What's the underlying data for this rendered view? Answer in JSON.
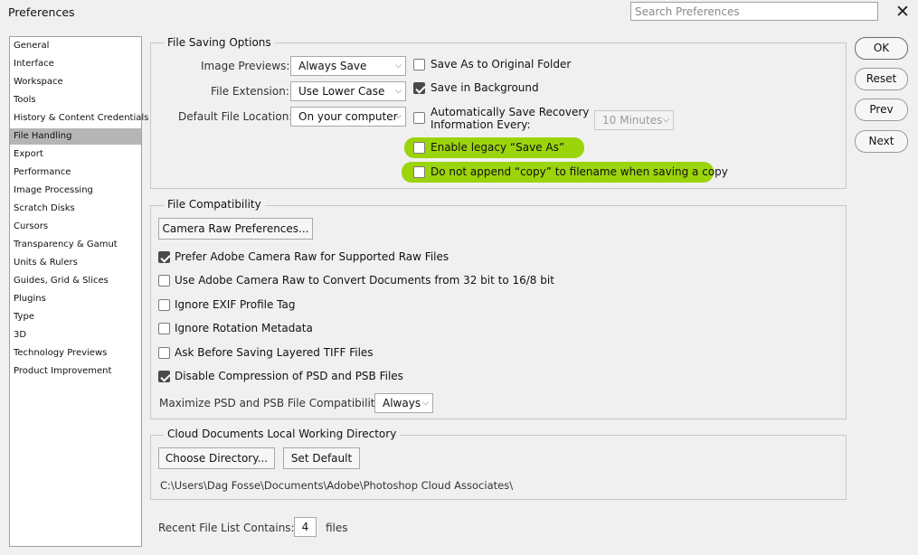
{
  "window": {
    "title": "Preferences",
    "search_placeholder": "Search Preferences"
  },
  "sidebar": {
    "items": [
      {
        "label": "General"
      },
      {
        "label": "Interface"
      },
      {
        "label": "Workspace"
      },
      {
        "label": "Tools"
      },
      {
        "label": "History & Content Credentials"
      },
      {
        "label": "File Handling",
        "selected": true
      },
      {
        "label": "Export"
      },
      {
        "label": "Performance"
      },
      {
        "label": "Image Processing"
      },
      {
        "label": "Scratch Disks"
      },
      {
        "label": "Cursors"
      },
      {
        "label": "Transparency & Gamut"
      },
      {
        "label": "Units & Rulers"
      },
      {
        "label": "Guides, Grid & Slices"
      },
      {
        "label": "Plugins"
      },
      {
        "label": "Type"
      },
      {
        "label": "3D"
      },
      {
        "label": "Technology Previews"
      },
      {
        "label": "Product Improvement"
      }
    ]
  },
  "file_saving": {
    "legend": "File Saving Options",
    "image_previews": {
      "label": "Image Previews:",
      "value": "Always Save"
    },
    "file_extension": {
      "label": "File Extension:",
      "value": "Use Lower Case"
    },
    "default_location": {
      "label": "Default File Location:",
      "value": "On your computer"
    },
    "save_as_original": {
      "label": "Save As to Original Folder",
      "checked": false
    },
    "save_background": {
      "label": "Save in Background",
      "checked": true
    },
    "auto_recovery": {
      "label_line1": "Automatically Save Recovery",
      "label_line2": "Information Every:",
      "checked": false
    },
    "recovery_interval": {
      "value": "10 Minutes"
    },
    "legacy_save_as": {
      "label": "Enable legacy “Save As”",
      "checked": false
    },
    "no_copy_append": {
      "label": "Do not append “copy” to filename when saving a copy",
      "checked": false
    }
  },
  "file_compat": {
    "legend": "File Compatibility",
    "camera_raw_button": "Camera Raw Preferences...",
    "options": [
      {
        "label": "Prefer Adobe Camera Raw for Supported Raw Files",
        "checked": true
      },
      {
        "label": "Use Adobe Camera Raw to Convert Documents from 32 bit to 16/8 bit",
        "checked": false
      },
      {
        "label": "Ignore EXIF Profile Tag",
        "checked": false
      },
      {
        "label": "Ignore Rotation Metadata",
        "checked": false
      },
      {
        "label": "Ask Before Saving Layered TIFF Files",
        "checked": false
      },
      {
        "label": "Disable Compression of PSD and PSB Files",
        "checked": true
      }
    ],
    "maximize": {
      "label": "Maximize PSD and PSB File Compatibility:",
      "value": "Always"
    }
  },
  "cloud": {
    "legend": "Cloud Documents Local Working Directory",
    "choose_button": "Choose Directory...",
    "default_button": "Set Default",
    "path": "C:\\Users\\Dag Fosse\\Documents\\Adobe\\Photoshop Cloud Associates\\"
  },
  "recent": {
    "label": "Recent File List Contains:",
    "value": "4",
    "suffix": "files"
  },
  "buttons": {
    "ok": "OK",
    "reset": "Reset",
    "prev": "Prev",
    "next": "Next"
  },
  "colors": {
    "highlight": "#9bd40b",
    "selected_item": "#b5b5b5",
    "background": "#f0f0f0"
  }
}
